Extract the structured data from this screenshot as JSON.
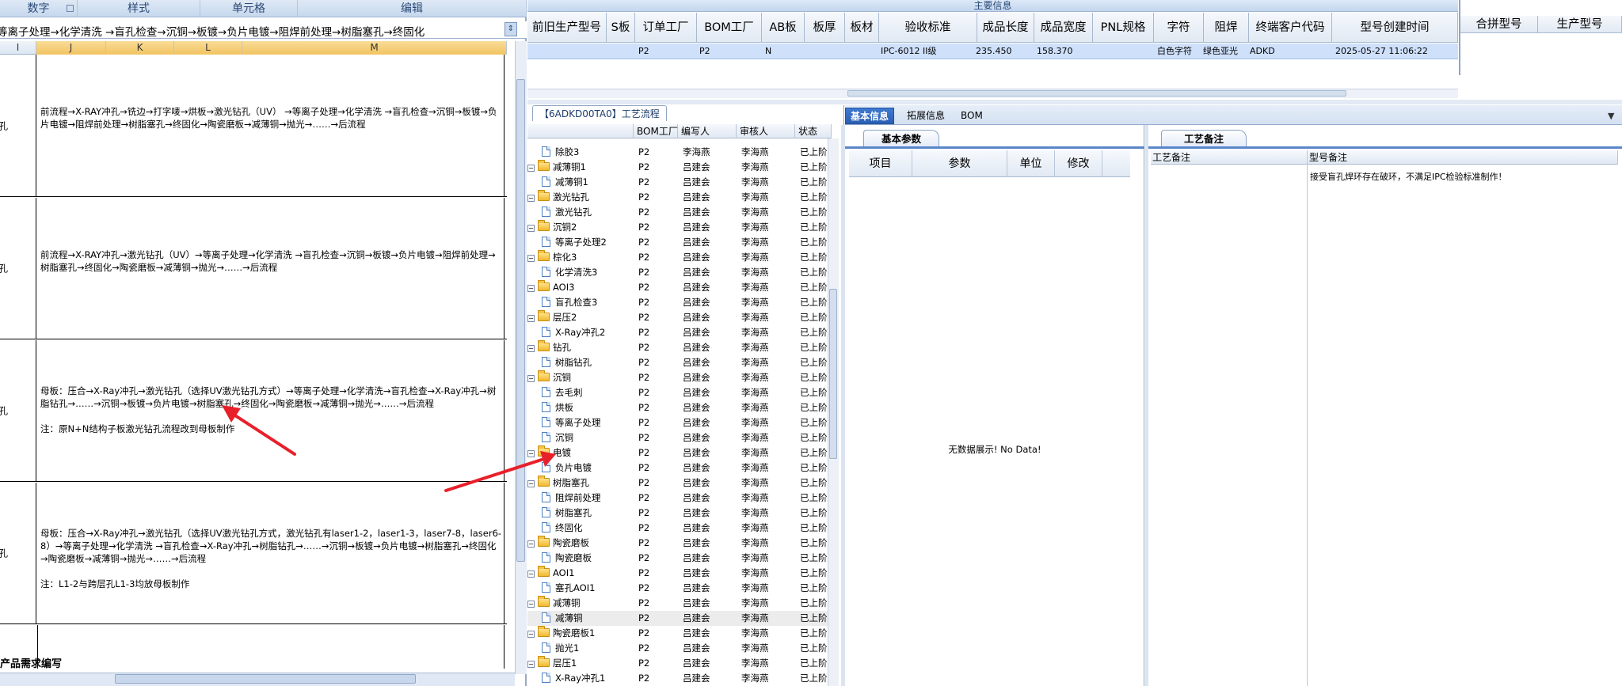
{
  "excel": {
    "ribbon": [
      "数字",
      "样式",
      "单元格",
      "编辑"
    ],
    "formula": "等离子处理→化学清洗 →盲孔检查→沉铜→板镀→负片电镀→阻焊前处理→树脂塞孔→终固化",
    "col_headers": [
      "I",
      "J",
      "K",
      "L",
      "M"
    ],
    "rows": [
      {
        "left": "孔",
        "text": "前流程→X-RAY冲孔→铣边→打字唛→烘板→激光钻孔（UV） →等离子处理→化学清洗 →盲孔检查→沉铜→板镀→负片电镀→阻焊前处理→树脂塞孔→终固化→陶瓷磨板→减薄铜→抛光→……→后流程"
      },
      {
        "left": "孔",
        "text": "前流程→X-RAY冲孔→激光钻孔（UV）→等离子处理→化学清洗 →盲孔检查→沉铜→板镀→负片电镀→阻焊前处理→树脂塞孔→终固化→陶瓷磨板→减薄铜→抛光→……→后流程"
      },
      {
        "left": "孔",
        "text": "母板：压合→X-Ray冲孔→激光钻孔（选择UV激光钻孔方式）→等离子处理→化学清洗→盲孔检查→X-Ray冲孔→树脂钻孔→……→沉铜→板镀→负片电镀→树脂塞孔→终固化→陶瓷磨板→减薄铜→抛光→……→后流程\n\n注：原N+N结构子板激光钻孔流程改到母板制作"
      },
      {
        "left": "孔",
        "text": "母板：压合→X-Ray冲孔→激光钻孔（选择UV激光钻孔方式，激光钻孔有laser1-2，laser1-3，laser7-8，laser6-8）→等离子处理→化学清洗 →盲孔检查→X-Ray冲孔→树脂钻孔→……→沉铜→板镀→负片电镀→树脂塞孔→终固化→陶瓷磨板→减薄铜→抛光→……→后流程\n\n注：L1-2与跨层孔L1-3均放母板制作"
      }
    ],
    "bottom_text": "产品需求编写"
  },
  "main_grid": {
    "group_title": "主要信息",
    "columns": [
      "前旧生产型号",
      "S板",
      "订单工厂",
      "BOM工厂",
      "AB板",
      "板厚",
      "板材",
      "验收标准",
      "成品长度",
      "成品宽度",
      "PNL规格",
      "字符",
      "阻焊",
      "终端客户代码",
      "型号创建时间"
    ],
    "row": {
      "order_factory": "P2",
      "bom_factory": "P2",
      "ab": "N",
      "standard": "IPC-6012 II级",
      "length": "235.450",
      "width": "158.370",
      "char": "白色字符",
      "mask": "绿色亚光",
      "customer": "ADKD",
      "created": "2025-05-27 11:06:22"
    },
    "side_columns": [
      "合拼型号",
      "生产型号"
    ]
  },
  "tree": {
    "tab": "【6ADKD00TA0】工艺流程",
    "headers": [
      "BOM工厂",
      "编写人",
      "审核人",
      "状态"
    ],
    "rows": [
      {
        "name": "除胶3",
        "type": "doc",
        "bom": "P2",
        "writer": "李海燕",
        "auditor": "李海燕",
        "status": "已上阶"
      },
      {
        "name": "减薄铜1",
        "type": "folder",
        "bom": "P2",
        "writer": "吕建会",
        "auditor": "李海燕",
        "status": "已上阶"
      },
      {
        "name": "减薄铜1",
        "type": "doc",
        "bom": "P2",
        "writer": "吕建会",
        "auditor": "李海燕",
        "status": "已上阶"
      },
      {
        "name": "激光钻孔",
        "type": "folder",
        "bom": "P2",
        "writer": "吕建会",
        "auditor": "李海燕",
        "status": "已上阶"
      },
      {
        "name": "激光钻孔",
        "type": "doc",
        "bom": "P2",
        "writer": "吕建会",
        "auditor": "李海燕",
        "status": "已上阶"
      },
      {
        "name": "沉铜2",
        "type": "folder",
        "bom": "P2",
        "writer": "吕建会",
        "auditor": "李海燕",
        "status": "已上阶"
      },
      {
        "name": "等离子处理2",
        "type": "doc",
        "bom": "P2",
        "writer": "吕建会",
        "auditor": "李海燕",
        "status": "已上阶"
      },
      {
        "name": "棕化3",
        "type": "folder",
        "bom": "P2",
        "writer": "吕建会",
        "auditor": "李海燕",
        "status": "已上阶"
      },
      {
        "name": "化学清洗3",
        "type": "doc",
        "bom": "P2",
        "writer": "吕建会",
        "auditor": "李海燕",
        "status": "已上阶"
      },
      {
        "name": "AOI3",
        "type": "folder",
        "bom": "P2",
        "writer": "吕建会",
        "auditor": "李海燕",
        "status": "已上阶"
      },
      {
        "name": "盲孔检查3",
        "type": "doc",
        "bom": "P2",
        "writer": "吕建会",
        "auditor": "李海燕",
        "status": "已上阶"
      },
      {
        "name": "层压2",
        "type": "folder",
        "bom": "P2",
        "writer": "吕建会",
        "auditor": "李海燕",
        "status": "已上阶"
      },
      {
        "name": "X-Ray冲孔2",
        "type": "doc",
        "bom": "P2",
        "writer": "吕建会",
        "auditor": "李海燕",
        "status": "已上阶"
      },
      {
        "name": "钻孔",
        "type": "folder",
        "bom": "P2",
        "writer": "吕建会",
        "auditor": "李海燕",
        "status": "已上阶"
      },
      {
        "name": "树脂钻孔",
        "type": "doc",
        "bom": "P2",
        "writer": "吕建会",
        "auditor": "李海燕",
        "status": "已上阶"
      },
      {
        "name": "沉铜",
        "type": "folder",
        "bom": "P2",
        "writer": "吕建会",
        "auditor": "李海燕",
        "status": "已上阶"
      },
      {
        "name": "去毛刺",
        "type": "doc",
        "bom": "P2",
        "writer": "吕建会",
        "auditor": "李海燕",
        "status": "已上阶"
      },
      {
        "name": "烘板",
        "type": "doc",
        "bom": "P2",
        "writer": "吕建会",
        "auditor": "李海燕",
        "status": "已上阶"
      },
      {
        "name": "等离子处理",
        "type": "doc",
        "bom": "P2",
        "writer": "吕建会",
        "auditor": "李海燕",
        "status": "已上阶"
      },
      {
        "name": "沉铜",
        "type": "doc",
        "bom": "P2",
        "writer": "吕建会",
        "auditor": "李海燕",
        "status": "已上阶"
      },
      {
        "name": "电镀",
        "type": "folder",
        "bom": "P2",
        "writer": "吕建会",
        "auditor": "李海燕",
        "status": "已上阶"
      },
      {
        "name": "负片电镀",
        "type": "doc",
        "bom": "P2",
        "writer": "吕建会",
        "auditor": "李海燕",
        "status": "已上阶"
      },
      {
        "name": "树脂塞孔",
        "type": "folder",
        "bom": "P2",
        "writer": "吕建会",
        "auditor": "李海燕",
        "status": "已上阶"
      },
      {
        "name": "阻焊前处理",
        "type": "doc",
        "bom": "P2",
        "writer": "吕建会",
        "auditor": "李海燕",
        "status": "已上阶"
      },
      {
        "name": "树脂塞孔",
        "type": "doc",
        "bom": "P2",
        "writer": "吕建会",
        "auditor": "李海燕",
        "status": "已上阶"
      },
      {
        "name": "终固化",
        "type": "doc",
        "bom": "P2",
        "writer": "吕建会",
        "auditor": "李海燕",
        "status": "已上阶"
      },
      {
        "name": "陶瓷磨板",
        "type": "folder",
        "bom": "P2",
        "writer": "吕建会",
        "auditor": "李海燕",
        "status": "已上阶"
      },
      {
        "name": "陶瓷磨板",
        "type": "doc",
        "bom": "P2",
        "writer": "吕建会",
        "auditor": "李海燕",
        "status": "已上阶"
      },
      {
        "name": "AOI1",
        "type": "folder",
        "bom": "P2",
        "writer": "吕建会",
        "auditor": "李海燕",
        "status": "已上阶"
      },
      {
        "name": "塞孔AOI1",
        "type": "doc",
        "bom": "P2",
        "writer": "吕建会",
        "auditor": "李海燕",
        "status": "已上阶"
      },
      {
        "name": "减薄铜",
        "type": "folder",
        "bom": "P2",
        "writer": "吕建会",
        "auditor": "李海燕",
        "status": "已上阶"
      },
      {
        "name": "减薄铜",
        "type": "doc",
        "bom": "P2",
        "writer": "吕建会",
        "auditor": "李海燕",
        "status": "已上阶"
      },
      {
        "name": "陶瓷磨板1",
        "type": "folder",
        "bom": "P2",
        "writer": "吕建会",
        "auditor": "李海燕",
        "status": "已上阶"
      },
      {
        "name": "抛光1",
        "type": "doc",
        "bom": "P2",
        "writer": "吕建会",
        "auditor": "李海燕",
        "status": "已上阶"
      },
      {
        "name": "层压1",
        "type": "folder",
        "bom": "P2",
        "writer": "吕建会",
        "auditor": "李海燕",
        "status": "已上阶"
      },
      {
        "name": "X-Ray冲孔1",
        "type": "doc",
        "bom": "P2",
        "writer": "吕建会",
        "auditor": "李海燕",
        "status": "已上阶"
      }
    ]
  },
  "right_tabs": [
    "基本信息",
    "拓展信息",
    "BOM"
  ],
  "basic_params": {
    "tab": "基本参数",
    "headers": [
      "项目",
      "参数",
      "单位",
      "修改"
    ],
    "empty": "无数据展示! No Data!"
  },
  "process_notes": {
    "tab": "工艺备注",
    "headers": [
      "工艺备注",
      "型号备注"
    ],
    "note": "接受盲孔焊环存在破环，不满足IPC检验标准制作！"
  },
  "colors": {
    "arrow": "#e8202a",
    "selection": "#cfe0fb",
    "accent": "#2a5fb3"
  }
}
